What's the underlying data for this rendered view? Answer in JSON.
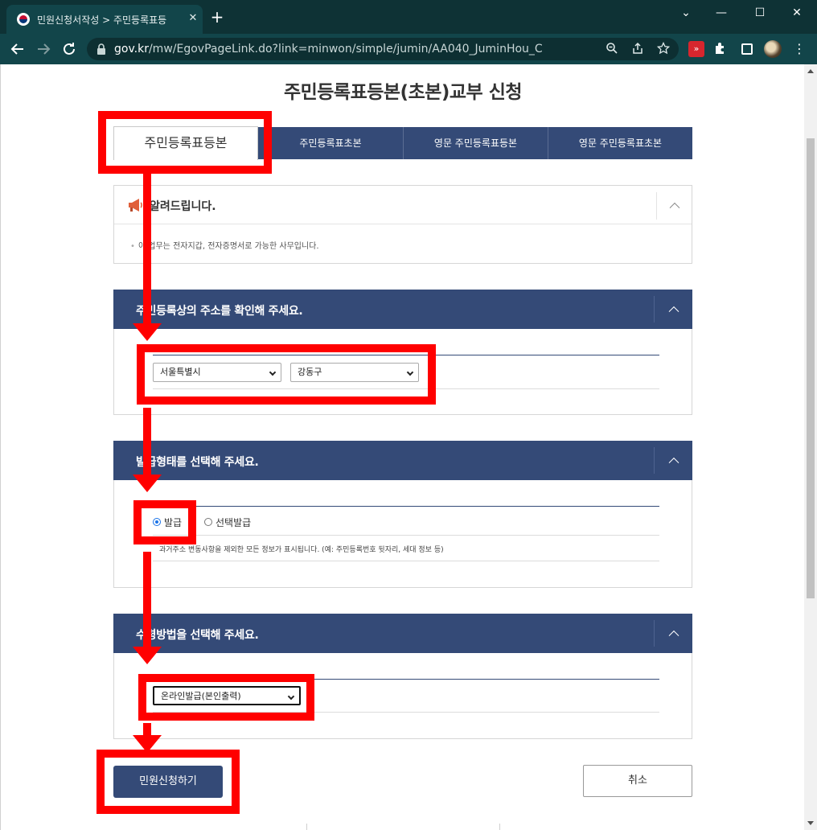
{
  "browser": {
    "tab_title": "민원신청서작성 > 주민등록표등",
    "tab_close": "✕",
    "new_tab": "+",
    "window_min": "—",
    "window_max": "☐",
    "window_close": "✕",
    "tab_search": "⌄",
    "url_host": "gov.kr",
    "url_path": "/mw/EgovPageLink.do?link=minwon/simple/jumin/AA040_JuminHou_C",
    "ext_red_label": "»"
  },
  "page": {
    "title": "주민등록표등본(초본)교부 신청",
    "tabs": [
      {
        "label": "주민등록표등본"
      },
      {
        "label": "주민등록표초본"
      },
      {
        "label": "영문 주민등록표등본"
      },
      {
        "label": "영문 주민등록표초본"
      }
    ],
    "notice": {
      "heading": "알려드립니다.",
      "body": "이 업무는 전자지갑, 전자증명서로 가능한 사무입니다."
    },
    "address_section": {
      "title": "주민등록상의 주소를 확인해 주세요.",
      "sido_value": "서울특별시",
      "sigungu_value": "강동구"
    },
    "issue_type_section": {
      "title": "발급형태를 선택해 주세요.",
      "option_full": "발급",
      "option_select": "선택발급",
      "selected": "발급",
      "description": "과거주소 변동사항을 제외한 모든 정보가 표시됩니다. (예: 주민등록번호 뒷자리, 세대 정보 등)"
    },
    "receive_section": {
      "title": "수령방법을 선택해 주세요.",
      "method_value": "온라인발급(본인출력)"
    },
    "submit_label": "민원신청하기",
    "cancel_label": "취소"
  },
  "annotation": {
    "color": "#ff0000"
  },
  "colors": {
    "brand_navy": "#344a77",
    "browser_frame": "#0f3b3f",
    "radio_selected": "#1a73e8"
  }
}
